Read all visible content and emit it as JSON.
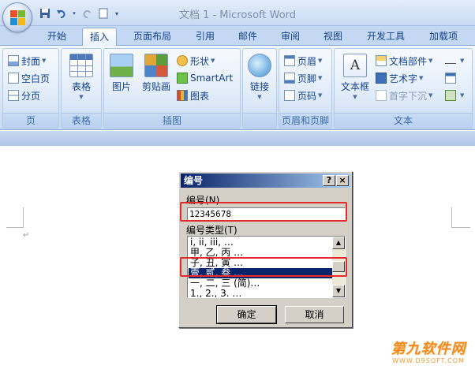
{
  "window": {
    "title": "文档 1 - Microsoft Word"
  },
  "tabs": [
    {
      "label": "开始"
    },
    {
      "label": "插入",
      "active": true
    },
    {
      "label": "页面布局"
    },
    {
      "label": "引用"
    },
    {
      "label": "邮件"
    },
    {
      "label": "审阅"
    },
    {
      "label": "视图"
    },
    {
      "label": "开发工具"
    },
    {
      "label": "加载项"
    }
  ],
  "ribbon": {
    "groups": {
      "pages": {
        "label": "页",
        "items": [
          "封面",
          "空白页",
          "分页"
        ]
      },
      "tables": {
        "label": "表格",
        "items": [
          "表格"
        ]
      },
      "illustrations": {
        "label": "插图",
        "items": [
          "图片",
          "剪贴画",
          "形状",
          "SmartArt",
          "图表"
        ]
      },
      "links": {
        "label": "",
        "items": [
          "链接"
        ]
      },
      "header_footer": {
        "label": "页眉和页脚",
        "items": [
          "页眉",
          "页脚",
          "页码"
        ]
      },
      "text": {
        "label": "文本",
        "items": [
          "文本框",
          "文档部件",
          "艺术字",
          "首字下沉"
        ]
      }
    }
  },
  "dialog": {
    "title": "编号",
    "help_button": "?",
    "close_button": "×",
    "number_label": "编号(N)",
    "number_value": "12345678",
    "type_label": "编号类型(T)",
    "types": [
      "i, ii, iii, …",
      "甲, 乙, 丙 …",
      "子, 丑, 寅 …",
      "壹, 贰, 叁 …",
      "一, 二, 三 (简)…",
      "1., 2., 3. …"
    ],
    "selected_index": 3,
    "ok_label": "确定",
    "cancel_label": "取消"
  },
  "watermark": {
    "main": "第九软件网",
    "sub": "WWW.D9SOFT.COM"
  },
  "colors": {
    "title_gradient_start": "#0a246a",
    "selection": "#0a246a",
    "highlight": "#e32b2b",
    "ribbon_text": "#15428b",
    "watermark": "#f08a1c"
  }
}
